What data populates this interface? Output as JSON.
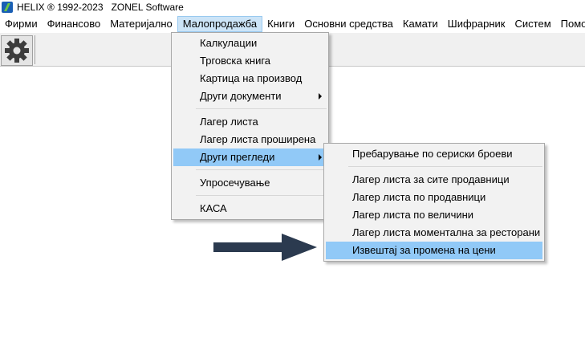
{
  "title": {
    "text": "HELIX ® 1992-2023   ZONEL Software"
  },
  "menubar": {
    "items": [
      {
        "label": "Фирми"
      },
      {
        "label": "Финансово"
      },
      {
        "label": "Материјално"
      },
      {
        "label": "Малопродажба",
        "active": true
      },
      {
        "label": "Книги"
      },
      {
        "label": "Основни средства"
      },
      {
        "label": "Камати"
      },
      {
        "label": "Шифрарник"
      },
      {
        "label": "Систем"
      },
      {
        "label": "Помош"
      }
    ]
  },
  "toolbar": {
    "settings_icon": "gear-icon"
  },
  "main_menu": {
    "items": [
      {
        "label": "Калкулации"
      },
      {
        "label": "Трговска книга"
      },
      {
        "label": "Картица на производ"
      },
      {
        "label": "Други документи"
      },
      {
        "label": "Лагер листа"
      },
      {
        "label": "Лагер листа проширена"
      },
      {
        "label": "Други прегледи"
      },
      {
        "label": "Упросечување"
      },
      {
        "label": "КАСА"
      }
    ]
  },
  "sub_menu": {
    "items": [
      {
        "label": "Пребарување по сериски броеви"
      },
      {
        "label": "Лагер листа за сите продавници"
      },
      {
        "label": "Лагер листа по продавници"
      },
      {
        "label": "Лагер листа по величини"
      },
      {
        "label": "Лагер листа моментална за ресторани"
      },
      {
        "label": "Извештај за промена на цени"
      }
    ]
  },
  "colors": {
    "highlight": "#91c9f7",
    "menubar_active": "#cce4f7",
    "arrow": "#2b3a4f"
  }
}
